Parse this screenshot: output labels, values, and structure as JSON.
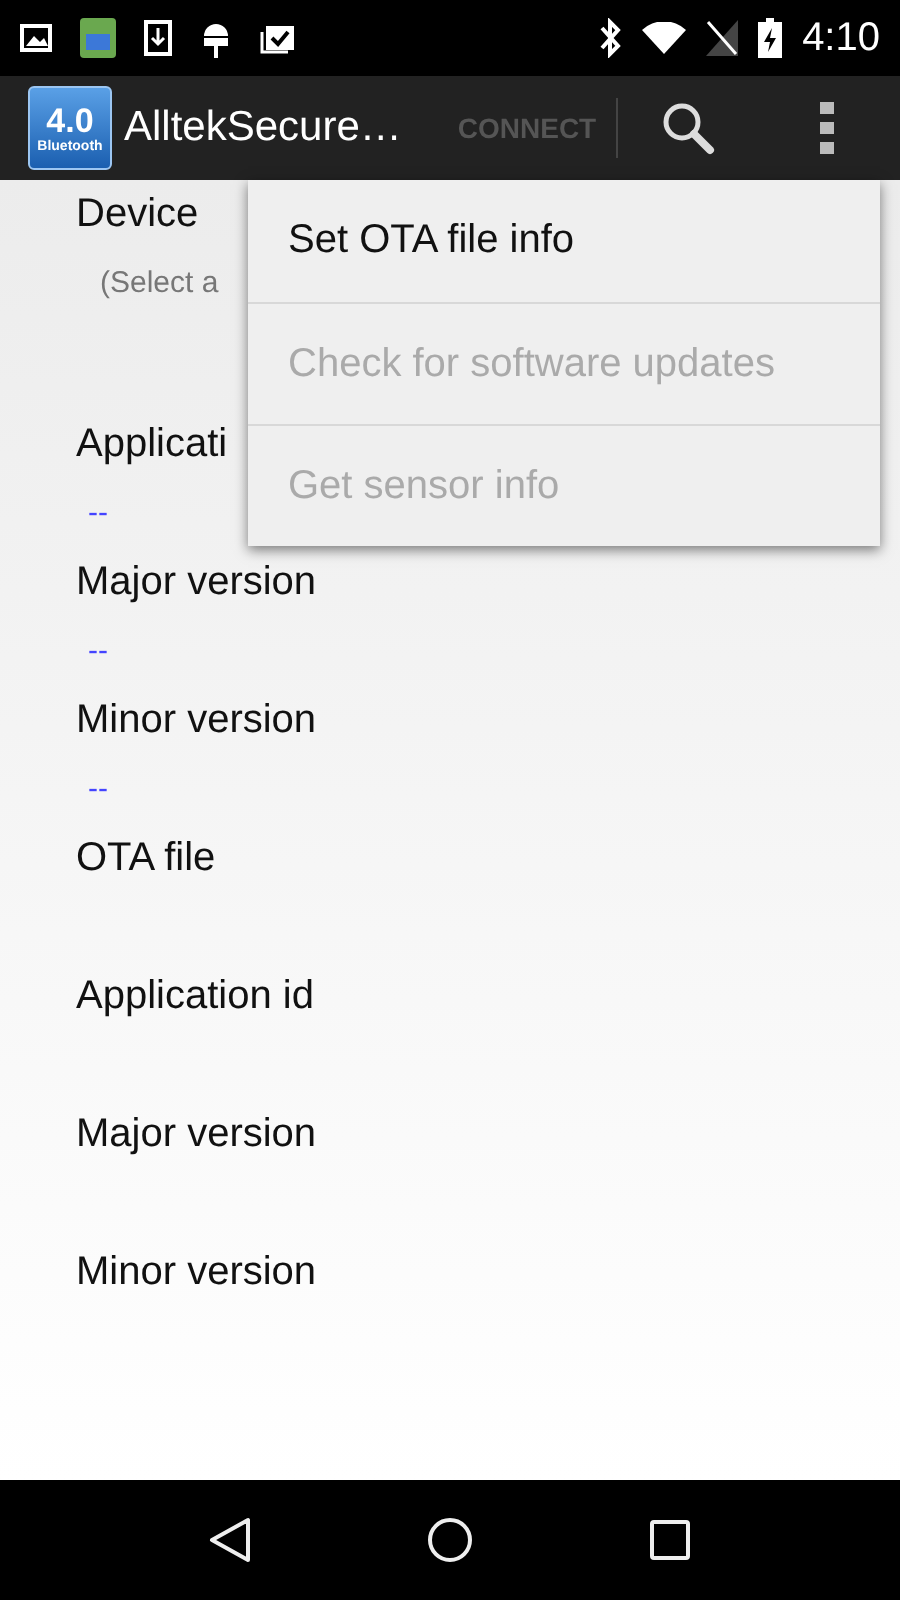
{
  "status_bar": {
    "time": "4:10"
  },
  "app_bar": {
    "title": "AlltekSecure…",
    "logo_text": "4.0",
    "logo_caption": "Bluetooth",
    "action": {
      "label": "CONNECT",
      "disabled": true
    }
  },
  "fields": [
    {
      "kind": "selector",
      "label": "Device",
      "value": "(Select a"
    },
    {
      "kind": "info",
      "label": "Applicati",
      "value": "--"
    },
    {
      "kind": "info",
      "label": "Major version",
      "value": "--"
    },
    {
      "kind": "info",
      "label": "Minor version",
      "value": "--"
    },
    {
      "kind": "info",
      "label": "OTA file"
    },
    {
      "kind": "info",
      "label": "Application id"
    },
    {
      "kind": "info",
      "label": "Major version"
    },
    {
      "kind": "info",
      "label": "Minor version"
    }
  ],
  "menu": [
    {
      "label": "Set OTA file info",
      "disabled": false
    },
    {
      "label": "Check for software updates",
      "disabled": true
    },
    {
      "label": "Get sensor info",
      "disabled": true
    }
  ]
}
